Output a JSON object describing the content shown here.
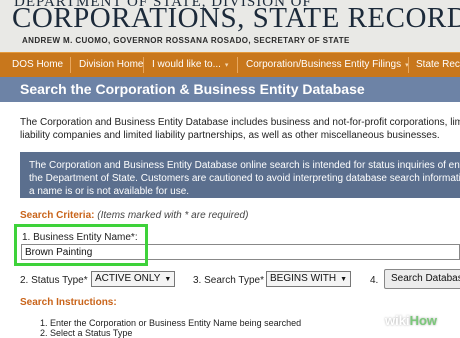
{
  "header": {
    "agency_line": "Department of State, Division of",
    "agency_name": "Corporations, State Records & UCC",
    "officials": "ANDREW M. CUOMO, GOVERNOR      ROSSANA ROSADO, SECRETARY OF STATE"
  },
  "nav": {
    "items": [
      {
        "label": "DOS Home"
      },
      {
        "label": "Division Home"
      },
      {
        "label": "I would like to..."
      },
      {
        "label": "Corporation/Business Entity Filings"
      },
      {
        "label": "State Rec"
      }
    ],
    "caret": "▾"
  },
  "page": {
    "title": "Search the Corporation & Business Entity Database",
    "intro_line1": "The Corporation and Business Entity Database includes business and not-for-profit corporations, limited",
    "intro_line2": "liability companies and limited liability partnerships, as well as other miscellaneous businesses.",
    "notice_line1": "The Corporation and Business Entity Database online search is intended for status inquiries of entities",
    "notice_line2": "the Department of State. Customers are cautioned to avoid interpreting database search information a",
    "notice_line3": "a name is or is not available for use."
  },
  "form": {
    "criteria_label": "Search Criteria:",
    "criteria_note": "(Items marked with * are required)",
    "field1_label": "1. Business Entity Name*:",
    "field1_value": "Brown Painting",
    "field2_label": "2. Status Type*",
    "field2_value": "ACTIVE ONLY",
    "field3_label": "3. Search Type*",
    "field3_value": "BEGINS WITH",
    "field4_label": "4.",
    "search_button": "Search Databas",
    "dropdown_arrow": "▼"
  },
  "instructions": {
    "heading": "Search Instructions:",
    "step1": "1. Enter the Corporation or Business Entity Name being searched",
    "step2": "2. Select a Status Type"
  },
  "watermark": {
    "wiki": "wiki",
    "how": "How"
  },
  "colors": {
    "nav_bg": "#c8771c",
    "title_bar_bg": "#6d83a6",
    "notice_bg": "#5b6f8e",
    "accent_orange": "#c9641a",
    "highlight_green": "#3ed23a"
  }
}
